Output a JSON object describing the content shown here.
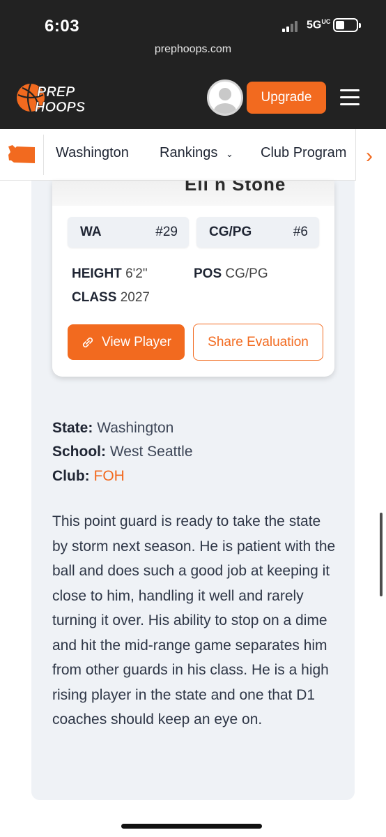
{
  "status_bar": {
    "time": "6:03",
    "network": "5G",
    "network_suffix": "UC"
  },
  "browser": {
    "url": "prephoops.com"
  },
  "header": {
    "logo_line1": "PREP",
    "logo_line2": "HOOPS",
    "upgrade_label": "Upgrade"
  },
  "nav": {
    "items": [
      "Washington",
      "Rankings",
      "Club Program"
    ]
  },
  "player_card": {
    "name_fragment": "Eli n Stone",
    "state_rank": {
      "label": "WA",
      "value": "#29"
    },
    "position_rank": {
      "label": "CG/PG",
      "value": "#6"
    },
    "height_label": "HEIGHT",
    "height_value": "6'2\"",
    "pos_label": "POS",
    "pos_value": "CG/PG",
    "class_label": "CLASS",
    "class_value": "2027",
    "view_button": "View Player",
    "share_button": "Share Evaluation"
  },
  "details": {
    "state_label": "State:",
    "state_value": "Washington",
    "school_label": "School:",
    "school_value": "West Seattle",
    "club_label": "Club:",
    "club_value": "FOH"
  },
  "evaluation": "This point guard is ready to take the state by storm next season. He is patient with the ball and does such a good job at keeping it close to him, handling it well and rarely turning it over. His ability to stop on a dime and hit the mid-range game separates him from other guards in his class. He is a high rising player in the state and one that D1 coaches should keep an eye on.",
  "colors": {
    "accent": "#f26a1f",
    "header_bg": "#222222",
    "panel_bg": "#eff2f6"
  }
}
